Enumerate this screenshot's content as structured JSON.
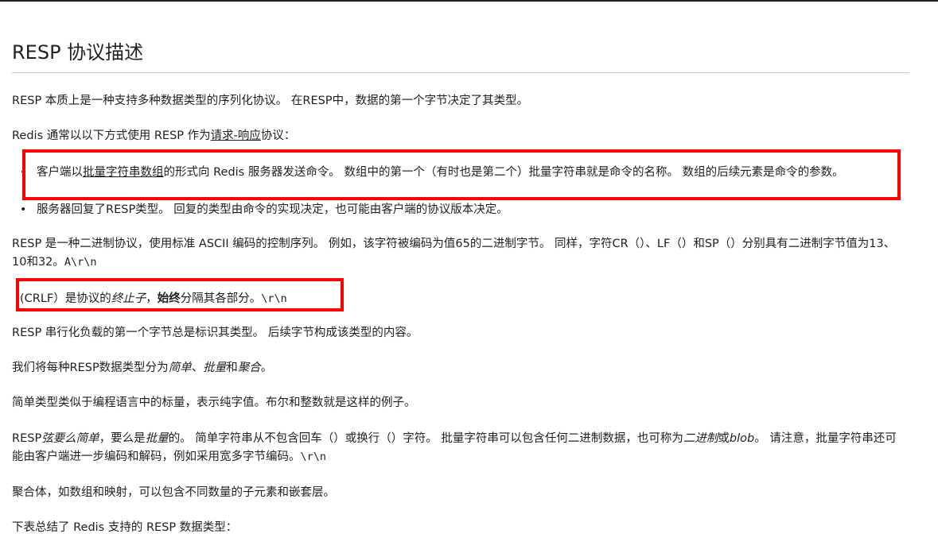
{
  "header": {
    "top_cut": "— — — — — — — — — — —"
  },
  "title": "RESP 协议描述",
  "paragraphs": {
    "p1": "RESP 本质上是一种支持多种数据类型的序列化协议。 在RESP中，数据的第一个字节决定了其类型。",
    "p2_a": "Redis 通常以以下方式使用 RESP 作为",
    "p2_link": "请求-响应",
    "p2_b": "协议：",
    "li1_a": "客户端以",
    "li1_link": "批量字符串数组",
    "li1_b": "的形式向 Redis 服务器发送命令。 数组中的第一个（有时也是第二个）批量字符串就是命令的名称。 数组的后续元素是命令的参数。",
    "li2": "服务器回复了RESP类型。 回复的类型由命令的实现决定，也可能由客户端的协议版本决定。",
    "p3_a": "RESP 是一种二进制协议，使用标准 ASCII 编码的控制序列。 例如，该字符被编码为值65的二进制字节。 同样，字符CR（）、LF（）和SP（）分别具有二进制字节值为13、10和32。",
    "p3_code": "A\\r\\n",
    "p4_a": "(CRLF）是协议的",
    "p4_em": "终止子",
    "p4_b": "，",
    "p4_strong": "始终",
    "p4_c": "分隔其各部分。",
    "p4_code": "\\r\\n",
    "p5": "RESP 串行化负载的第一个字节总是标识其类型。 后续字节构成该类型的内容。",
    "p6_a": "我们将每种RESP数据类型分为",
    "p6_em1": "简单",
    "p6_sep": "、",
    "p6_em2": "批量",
    "p6_and": "和",
    "p6_em3": "聚合",
    "p6_end": "。",
    "p7": "简单类型类似于编程语言中的标量，表示纯字值。布尔和整数就是这样的例子。",
    "p8_a": "RESP",
    "p8_em1": "弦要么简单",
    "p8_b": "，要么是",
    "p8_em2": "批量",
    "p8_c": "的。 简单字符串从不包含回车（）或换行（）字符。 批量字符串可以包含任何二进制数据，也可称为",
    "p8_em3": "二进制",
    "p8_or": "或",
    "p8_em4": "blob",
    "p8_d": "。 请注意，批量字符串还可能由客户端进一步编码和解码，例如采用宽多字节编码。",
    "p8_code": "\\r\\n",
    "p9": "聚合体，如数组和映射，可以包含不同数量的子元素和嵌套层。",
    "p10": "下表总结了 Redis 支持的 RESP 数据类型："
  },
  "bullet_glyph": "•",
  "highlight_color": "#ff0000"
}
